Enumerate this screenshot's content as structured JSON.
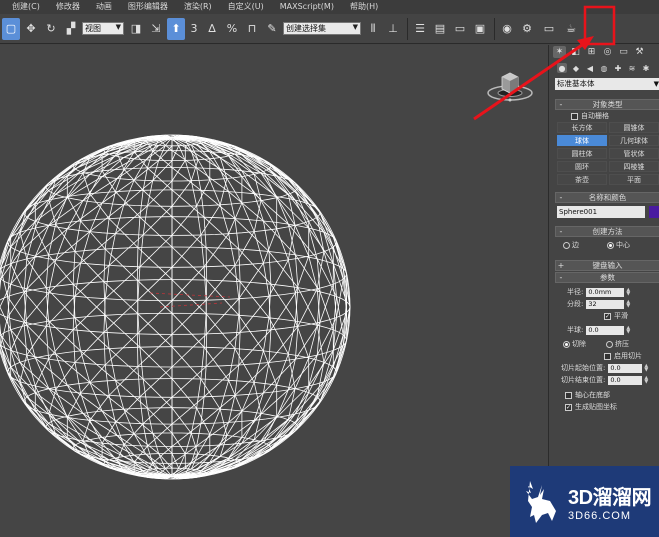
{
  "menubar": {
    "items": [
      "创建(C)",
      "修改器",
      "动画",
      "图形编辑器",
      "渲染(R)",
      "自定义(U)",
      "MAXScript(M)",
      "帮助(H)"
    ]
  },
  "toolbar": {
    "view_dropdown": "视图",
    "selection_set_dropdown": "创建选择集",
    "percent_snap": "%",
    "angle_snap_number": "3"
  },
  "panel": {
    "category_dropdown": "标准基本体",
    "object_type": {
      "title": "对象类型",
      "autogrid_label": "自动栅格",
      "buttons": [
        "长方体",
        "圆锥体",
        "球体",
        "几何球体",
        "圆柱体",
        "管状体",
        "圆环",
        "四棱锥",
        "茶壶",
        "平面"
      ],
      "active_button": "球体"
    },
    "name_color": {
      "title": "名称和颜色",
      "name_value": "Sphere001",
      "color": "#4a1aa0"
    },
    "creation_method": {
      "title": "创建方法",
      "option_edge": "边",
      "option_center": "中心",
      "selected": "中心"
    },
    "keyboard_entry": {
      "title": "键盘输入"
    },
    "parameters": {
      "title": "参数",
      "radius_label": "半径:",
      "radius_value": "0.0mm",
      "segments_label": "分段:",
      "segments_value": "32",
      "smooth_label": "平滑",
      "hemisphere_label": "半球:",
      "hemisphere_value": "0.0",
      "chop_label": "切除",
      "squash_label": "挤压",
      "enable_slice_label": "启用切片",
      "slice_from_label": "切片起始位置:",
      "slice_from_value": "0.0",
      "slice_to_label": "切片结束位置:",
      "slice_to_value": "0.0",
      "base_to_pivot_label": "轴心在底部",
      "gen_mapping_label": "生成贴图坐标"
    },
    "accent_color": "#4a8ad8"
  },
  "watermark": {
    "text_big": "3D溜溜网",
    "text_small": "3D66.COM"
  },
  "annotation": {
    "color": "#e8131b"
  }
}
